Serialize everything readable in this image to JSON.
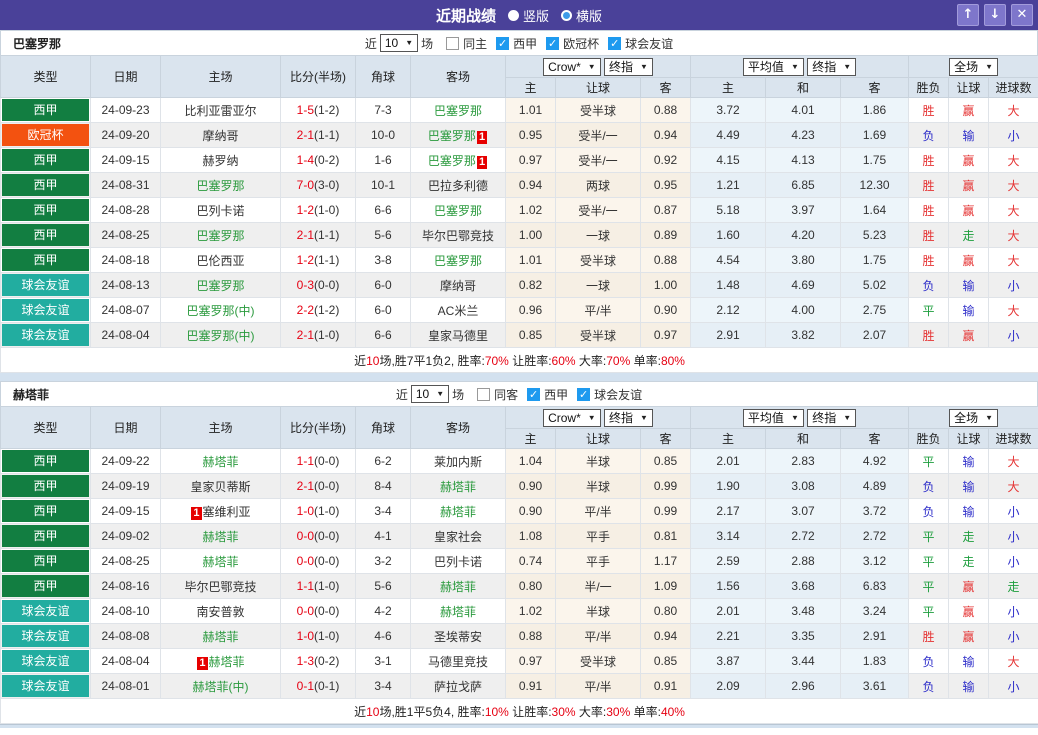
{
  "titlebar": {
    "title": "近期战绩",
    "radios": [
      {
        "label": "竖版",
        "selected": true
      },
      {
        "label": "横版",
        "selected": false
      }
    ]
  },
  "icons": {
    "up_arrow": "↑",
    "down_arrow": "↓",
    "close": "✕",
    "check": "✓",
    "dropdown_arrow": "▼"
  },
  "colors": {
    "titlebar": "#4a4199",
    "league_badge": "#127e41",
    "ucl_badge": "#f35210",
    "friendly_badge": "#22ada0",
    "win_red": "#e53333",
    "draw_green": "#1e9e3e",
    "lose_blue": "#2d2dc9",
    "score_red": "#e60012",
    "team_green": "#2a9a3d"
  },
  "columns": {
    "type": "类型",
    "date": "日期",
    "home": "主场",
    "score": "比分(半场)",
    "corner": "角球",
    "away": "客场",
    "g1_dd": [
      "Crow*",
      "终指"
    ],
    "g2_dd": [
      "平均值",
      "终指"
    ],
    "g3_dd": [
      "全场"
    ],
    "g1_sub": [
      "主",
      "让球",
      "客"
    ],
    "g2_sub": [
      "主",
      "和",
      "客"
    ],
    "g3_sub": [
      "胜负",
      "让球",
      "进球数"
    ]
  },
  "tables": [
    {
      "team": "巴塞罗那",
      "filter": {
        "near": "近",
        "count": "10",
        "games": "场",
        "same": {
          "label": "同主",
          "checked": false
        },
        "leagues": [
          {
            "label": "西甲",
            "checked": true
          },
          {
            "label": "欧冠杯",
            "checked": true
          },
          {
            "label": "球会友谊",
            "checked": true
          }
        ]
      },
      "rows": [
        {
          "league": "西甲",
          "lc": "league",
          "date": "24-09-23",
          "home": {
            "n": "比利亚雷亚尔",
            "g": false,
            "rc": ""
          },
          "score": [
            "1-5",
            "(1-2)"
          ],
          "corner": "7-3",
          "away": {
            "n": "巴塞罗那",
            "g": true,
            "rc": ""
          },
          "crow": [
            "1.01",
            "受半球",
            "0.88"
          ],
          "avg": [
            "3.72",
            "4.01",
            "1.86"
          ],
          "res": [
            [
              "胜",
              "r"
            ],
            [
              "赢",
              "r"
            ],
            [
              "大",
              "r"
            ]
          ]
        },
        {
          "league": "欧冠杯",
          "lc": "ucl",
          "date": "24-09-20",
          "home": {
            "n": "摩纳哥",
            "g": false,
            "rc": ""
          },
          "score": [
            "2-1",
            "(1-1)"
          ],
          "corner": "10-0",
          "away": {
            "n": "巴塞罗那",
            "g": true,
            "rc": "1"
          },
          "crow": [
            "0.95",
            "受半/一",
            "0.94"
          ],
          "avg": [
            "4.49",
            "4.23",
            "1.69"
          ],
          "res": [
            [
              "负",
              "b"
            ],
            [
              "输",
              "b"
            ],
            [
              "小",
              "b"
            ]
          ]
        },
        {
          "league": "西甲",
          "lc": "league",
          "date": "24-09-15",
          "home": {
            "n": "赫罗纳",
            "g": false,
            "rc": ""
          },
          "score": [
            "1-4",
            "(0-2)"
          ],
          "corner": "1-6",
          "away": {
            "n": "巴塞罗那",
            "g": true,
            "rc": "1"
          },
          "crow": [
            "0.97",
            "受半/一",
            "0.92"
          ],
          "avg": [
            "4.15",
            "4.13",
            "1.75"
          ],
          "res": [
            [
              "胜",
              "r"
            ],
            [
              "赢",
              "r"
            ],
            [
              "大",
              "r"
            ]
          ]
        },
        {
          "league": "西甲",
          "lc": "league",
          "date": "24-08-31",
          "home": {
            "n": "巴塞罗那",
            "g": true,
            "rc": ""
          },
          "score": [
            "7-0",
            "(3-0)"
          ],
          "corner": "10-1",
          "away": {
            "n": "巴拉多利德",
            "g": false,
            "rc": ""
          },
          "crow": [
            "0.94",
            "两球",
            "0.95"
          ],
          "avg": [
            "1.21",
            "6.85",
            "12.30"
          ],
          "res": [
            [
              "胜",
              "r"
            ],
            [
              "赢",
              "r"
            ],
            [
              "大",
              "r"
            ]
          ]
        },
        {
          "league": "西甲",
          "lc": "league",
          "date": "24-08-28",
          "home": {
            "n": "巴列卡诺",
            "g": false,
            "rc": ""
          },
          "score": [
            "1-2",
            "(1-0)"
          ],
          "corner": "6-6",
          "away": {
            "n": "巴塞罗那",
            "g": true,
            "rc": ""
          },
          "crow": [
            "1.02",
            "受半/一",
            "0.87"
          ],
          "avg": [
            "5.18",
            "3.97",
            "1.64"
          ],
          "res": [
            [
              "胜",
              "r"
            ],
            [
              "赢",
              "r"
            ],
            [
              "大",
              "r"
            ]
          ]
        },
        {
          "league": "西甲",
          "lc": "league",
          "date": "24-08-25",
          "home": {
            "n": "巴塞罗那",
            "g": true,
            "rc": ""
          },
          "score": [
            "2-1",
            "(1-1)"
          ],
          "corner": "5-6",
          "away": {
            "n": "毕尔巴鄂竞技",
            "g": false,
            "rc": ""
          },
          "crow": [
            "1.00",
            "一球",
            "0.89"
          ],
          "avg": [
            "1.60",
            "4.20",
            "5.23"
          ],
          "res": [
            [
              "胜",
              "r"
            ],
            [
              "走",
              "g"
            ],
            [
              "大",
              "r"
            ]
          ]
        },
        {
          "league": "西甲",
          "lc": "league",
          "date": "24-08-18",
          "home": {
            "n": "巴伦西亚",
            "g": false,
            "rc": ""
          },
          "score": [
            "1-2",
            "(1-1)"
          ],
          "corner": "3-8",
          "away": {
            "n": "巴塞罗那",
            "g": true,
            "rc": ""
          },
          "crow": [
            "1.01",
            "受半球",
            "0.88"
          ],
          "avg": [
            "4.54",
            "3.80",
            "1.75"
          ],
          "res": [
            [
              "胜",
              "r"
            ],
            [
              "赢",
              "r"
            ],
            [
              "大",
              "r"
            ]
          ]
        },
        {
          "league": "球会友谊",
          "lc": "friendly",
          "date": "24-08-13",
          "home": {
            "n": "巴塞罗那",
            "g": true,
            "rc": ""
          },
          "score": [
            "0-3",
            "(0-0)"
          ],
          "corner": "6-0",
          "away": {
            "n": "摩纳哥",
            "g": false,
            "rc": ""
          },
          "crow": [
            "0.82",
            "一球",
            "1.00"
          ],
          "avg": [
            "1.48",
            "4.69",
            "5.02"
          ],
          "res": [
            [
              "负",
              "b"
            ],
            [
              "输",
              "b"
            ],
            [
              "小",
              "b"
            ]
          ]
        },
        {
          "league": "球会友谊",
          "lc": "friendly",
          "date": "24-08-07",
          "home": {
            "n": "巴塞罗那(中)",
            "g": true,
            "rc": ""
          },
          "score": [
            "2-2",
            "(1-2)"
          ],
          "corner": "6-0",
          "away": {
            "n": "AC米兰",
            "g": false,
            "rc": ""
          },
          "crow": [
            "0.96",
            "平/半",
            "0.90"
          ],
          "avg": [
            "2.12",
            "4.00",
            "2.75"
          ],
          "res": [
            [
              "平",
              "g"
            ],
            [
              "输",
              "b"
            ],
            [
              "大",
              "r"
            ]
          ]
        },
        {
          "league": "球会友谊",
          "lc": "friendly",
          "date": "24-08-04",
          "home": {
            "n": "巴塞罗那(中)",
            "g": true,
            "rc": ""
          },
          "score": [
            "2-1",
            "(1-0)"
          ],
          "corner": "6-6",
          "away": {
            "n": "皇家马德里",
            "g": false,
            "rc": ""
          },
          "crow": [
            "0.85",
            "受半球",
            "0.97"
          ],
          "avg": [
            "2.91",
            "3.82",
            "2.07"
          ],
          "res": [
            [
              "胜",
              "r"
            ],
            [
              "赢",
              "r"
            ],
            [
              "小",
              "b"
            ]
          ]
        }
      ],
      "summary": [
        [
          "近",
          false
        ],
        [
          "10",
          true
        ],
        [
          "场,胜7平1负2, 胜率:",
          false
        ],
        [
          "70%",
          true
        ],
        [
          " 让胜率:",
          false
        ],
        [
          "60%",
          true
        ],
        [
          " 大率:",
          false
        ],
        [
          "70%",
          true
        ],
        [
          " 单率:",
          false
        ],
        [
          "80%",
          true
        ]
      ]
    },
    {
      "team": "赫塔菲",
      "filter": {
        "near": "近",
        "count": "10",
        "games": "场",
        "same": {
          "label": "同客",
          "checked": false
        },
        "leagues": [
          {
            "label": "西甲",
            "checked": true
          },
          {
            "label": "球会友谊",
            "checked": true
          }
        ]
      },
      "rows": [
        {
          "league": "西甲",
          "lc": "league",
          "date": "24-09-22",
          "home": {
            "n": "赫塔菲",
            "g": true,
            "rc": ""
          },
          "score": [
            "1-1",
            "(0-0)"
          ],
          "corner": "6-2",
          "away": {
            "n": "莱加内斯",
            "g": false,
            "rc": ""
          },
          "crow": [
            "1.04",
            "半球",
            "0.85"
          ],
          "avg": [
            "2.01",
            "2.83",
            "4.92"
          ],
          "res": [
            [
              "平",
              "g"
            ],
            [
              "输",
              "b"
            ],
            [
              "大",
              "r"
            ]
          ]
        },
        {
          "league": "西甲",
          "lc": "league",
          "date": "24-09-19",
          "home": {
            "n": "皇家贝蒂斯",
            "g": false,
            "rc": ""
          },
          "score": [
            "2-1",
            "(0-0)"
          ],
          "corner": "8-4",
          "away": {
            "n": "赫塔菲",
            "g": true,
            "rc": ""
          },
          "crow": [
            "0.90",
            "半球",
            "0.99"
          ],
          "avg": [
            "1.90",
            "3.08",
            "4.89"
          ],
          "res": [
            [
              "负",
              "b"
            ],
            [
              "输",
              "b"
            ],
            [
              "大",
              "r"
            ]
          ]
        },
        {
          "league": "西甲",
          "lc": "league",
          "date": "24-09-15",
          "home": {
            "n": "塞维利亚",
            "g": false,
            "rc": "1"
          },
          "score": [
            "1-0",
            "(1-0)"
          ],
          "corner": "3-4",
          "away": {
            "n": "赫塔菲",
            "g": true,
            "rc": ""
          },
          "crow": [
            "0.90",
            "平/半",
            "0.99"
          ],
          "avg": [
            "2.17",
            "3.07",
            "3.72"
          ],
          "res": [
            [
              "负",
              "b"
            ],
            [
              "输",
              "b"
            ],
            [
              "小",
              "b"
            ]
          ]
        },
        {
          "league": "西甲",
          "lc": "league",
          "date": "24-09-02",
          "home": {
            "n": "赫塔菲",
            "g": true,
            "rc": ""
          },
          "score": [
            "0-0",
            "(0-0)"
          ],
          "corner": "4-1",
          "away": {
            "n": "皇家社会",
            "g": false,
            "rc": ""
          },
          "crow": [
            "1.08",
            "平手",
            "0.81"
          ],
          "avg": [
            "3.14",
            "2.72",
            "2.72"
          ],
          "res": [
            [
              "平",
              "g"
            ],
            [
              "走",
              "g"
            ],
            [
              "小",
              "b"
            ]
          ]
        },
        {
          "league": "西甲",
          "lc": "league",
          "date": "24-08-25",
          "home": {
            "n": "赫塔菲",
            "g": true,
            "rc": ""
          },
          "score": [
            "0-0",
            "(0-0)"
          ],
          "corner": "3-2",
          "away": {
            "n": "巴列卡诺",
            "g": false,
            "rc": ""
          },
          "crow": [
            "0.74",
            "平手",
            "1.17"
          ],
          "avg": [
            "2.59",
            "2.88",
            "3.12"
          ],
          "res": [
            [
              "平",
              "g"
            ],
            [
              "走",
              "g"
            ],
            [
              "小",
              "b"
            ]
          ]
        },
        {
          "league": "西甲",
          "lc": "league",
          "date": "24-08-16",
          "home": {
            "n": "毕尔巴鄂竞技",
            "g": false,
            "rc": ""
          },
          "score": [
            "1-1",
            "(1-0)"
          ],
          "corner": "5-6",
          "away": {
            "n": "赫塔菲",
            "g": true,
            "rc": ""
          },
          "crow": [
            "0.80",
            "半/一",
            "1.09"
          ],
          "avg": [
            "1.56",
            "3.68",
            "6.83"
          ],
          "res": [
            [
              "平",
              "g"
            ],
            [
              "赢",
              "r"
            ],
            [
              "走",
              "g"
            ]
          ]
        },
        {
          "league": "球会友谊",
          "lc": "friendly",
          "date": "24-08-10",
          "home": {
            "n": "南安普敦",
            "g": false,
            "rc": ""
          },
          "score": [
            "0-0",
            "(0-0)"
          ],
          "corner": "4-2",
          "away": {
            "n": "赫塔菲",
            "g": true,
            "rc": ""
          },
          "crow": [
            "1.02",
            "半球",
            "0.80"
          ],
          "avg": [
            "2.01",
            "3.48",
            "3.24"
          ],
          "res": [
            [
              "平",
              "g"
            ],
            [
              "赢",
              "r"
            ],
            [
              "小",
              "b"
            ]
          ]
        },
        {
          "league": "球会友谊",
          "lc": "friendly",
          "date": "24-08-08",
          "home": {
            "n": "赫塔菲",
            "g": true,
            "rc": ""
          },
          "score": [
            "1-0",
            "(1-0)"
          ],
          "corner": "4-6",
          "away": {
            "n": "圣埃蒂安",
            "g": false,
            "rc": ""
          },
          "crow": [
            "0.88",
            "平/半",
            "0.94"
          ],
          "avg": [
            "2.21",
            "3.35",
            "2.91"
          ],
          "res": [
            [
              "胜",
              "r"
            ],
            [
              "赢",
              "r"
            ],
            [
              "小",
              "b"
            ]
          ]
        },
        {
          "league": "球会友谊",
          "lc": "friendly",
          "date": "24-08-04",
          "home": {
            "n": "赫塔菲",
            "g": true,
            "rc": "1"
          },
          "score": [
            "1-3",
            "(0-2)"
          ],
          "corner": "3-1",
          "away": {
            "n": "马德里竞技",
            "g": false,
            "rc": ""
          },
          "crow": [
            "0.97",
            "受半球",
            "0.85"
          ],
          "avg": [
            "3.87",
            "3.44",
            "1.83"
          ],
          "res": [
            [
              "负",
              "b"
            ],
            [
              "输",
              "b"
            ],
            [
              "大",
              "r"
            ]
          ]
        },
        {
          "league": "球会友谊",
          "lc": "friendly",
          "date": "24-08-01",
          "home": {
            "n": "赫塔菲(中)",
            "g": true,
            "rc": ""
          },
          "score": [
            "0-1",
            "(0-1)"
          ],
          "corner": "3-4",
          "away": {
            "n": "萨拉戈萨",
            "g": false,
            "rc": ""
          },
          "crow": [
            "0.91",
            "平/半",
            "0.91"
          ],
          "avg": [
            "2.09",
            "2.96",
            "3.61"
          ],
          "res": [
            [
              "负",
              "b"
            ],
            [
              "输",
              "b"
            ],
            [
              "小",
              "b"
            ]
          ]
        }
      ],
      "summary": [
        [
          "近",
          false
        ],
        [
          "10",
          true
        ],
        [
          "场,胜1平5负4, 胜率:",
          false
        ],
        [
          "10%",
          true
        ],
        [
          " 让胜率:",
          false
        ],
        [
          "30%",
          true
        ],
        [
          " 大率:",
          false
        ],
        [
          "30%",
          true
        ],
        [
          " 单率:",
          false
        ],
        [
          "40%",
          true
        ]
      ]
    }
  ]
}
